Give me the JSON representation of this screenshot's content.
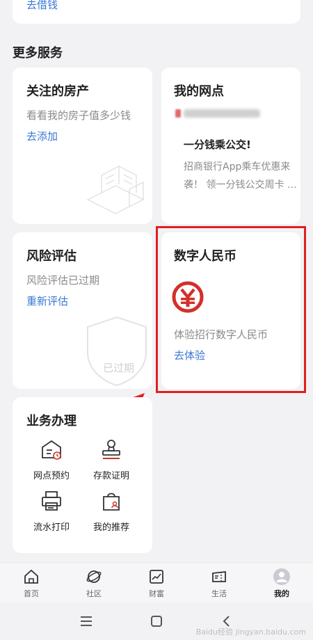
{
  "top_card": {
    "link": "去借钱"
  },
  "section_title": "更多服务",
  "cards": {
    "property": {
      "title": "关注的房产",
      "desc": "看看我的房子值多少钱",
      "link": "去添加"
    },
    "branch": {
      "title": "我的网点",
      "blurred_name": "",
      "promo_title": "一分钱乘公交!",
      "promo_desc_line1": "招商银行App乘车优惠来",
      "promo_desc_line2": "袭！ 领一分钱公交周卡 …"
    },
    "risk": {
      "title": "风险评估",
      "desc": "风险评估已过期",
      "link": "重新评估",
      "stamp": "已过期"
    },
    "ecny": {
      "title": "数字人民币",
      "desc": "体验招行数字人民币",
      "link": "去体验"
    },
    "business": {
      "title": "业务办理",
      "items": [
        {
          "label": "网点预约",
          "icon": "branch-booking-icon"
        },
        {
          "label": "存款证明",
          "icon": "deposit-certificate-icon"
        },
        {
          "label": "流水打印",
          "icon": "statement-print-icon"
        },
        {
          "label": "我的推荐",
          "icon": "my-referral-icon"
        }
      ]
    }
  },
  "tabbar": [
    {
      "label": "首页",
      "icon": "home-icon"
    },
    {
      "label": "社区",
      "icon": "community-icon"
    },
    {
      "label": "财富",
      "icon": "wealth-icon"
    },
    {
      "label": "生活",
      "icon": "life-icon"
    },
    {
      "label": "我的",
      "icon": "profile-icon",
      "active": true
    }
  ],
  "watermark": "Baidu经验 jingyan.baidu.com",
  "colors": {
    "accent_link": "#3a78d4",
    "highlight_red": "#e02020",
    "ecny_red": "#d4302b"
  }
}
